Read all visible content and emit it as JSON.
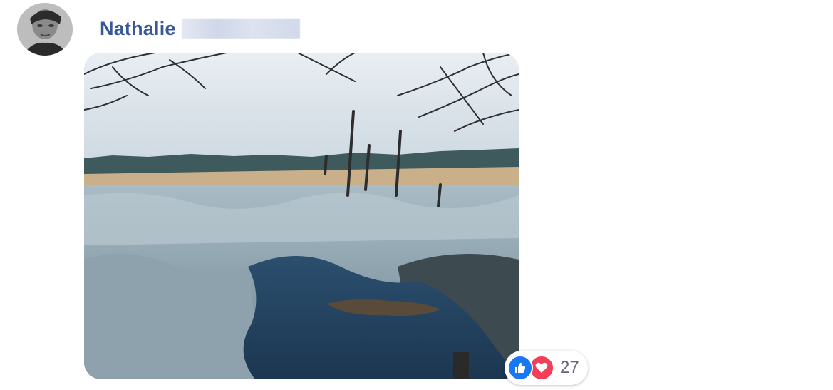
{
  "comment": {
    "author": {
      "first_name": "Nathalie",
      "last_name_redacted": true
    },
    "reactions": {
      "icons": [
        "like-icon",
        "love-icon"
      ],
      "count": "27"
    }
  },
  "colors": {
    "author_name": "#385898",
    "like": "#1877f2",
    "love": "#f33e58",
    "count_text": "#606770"
  }
}
